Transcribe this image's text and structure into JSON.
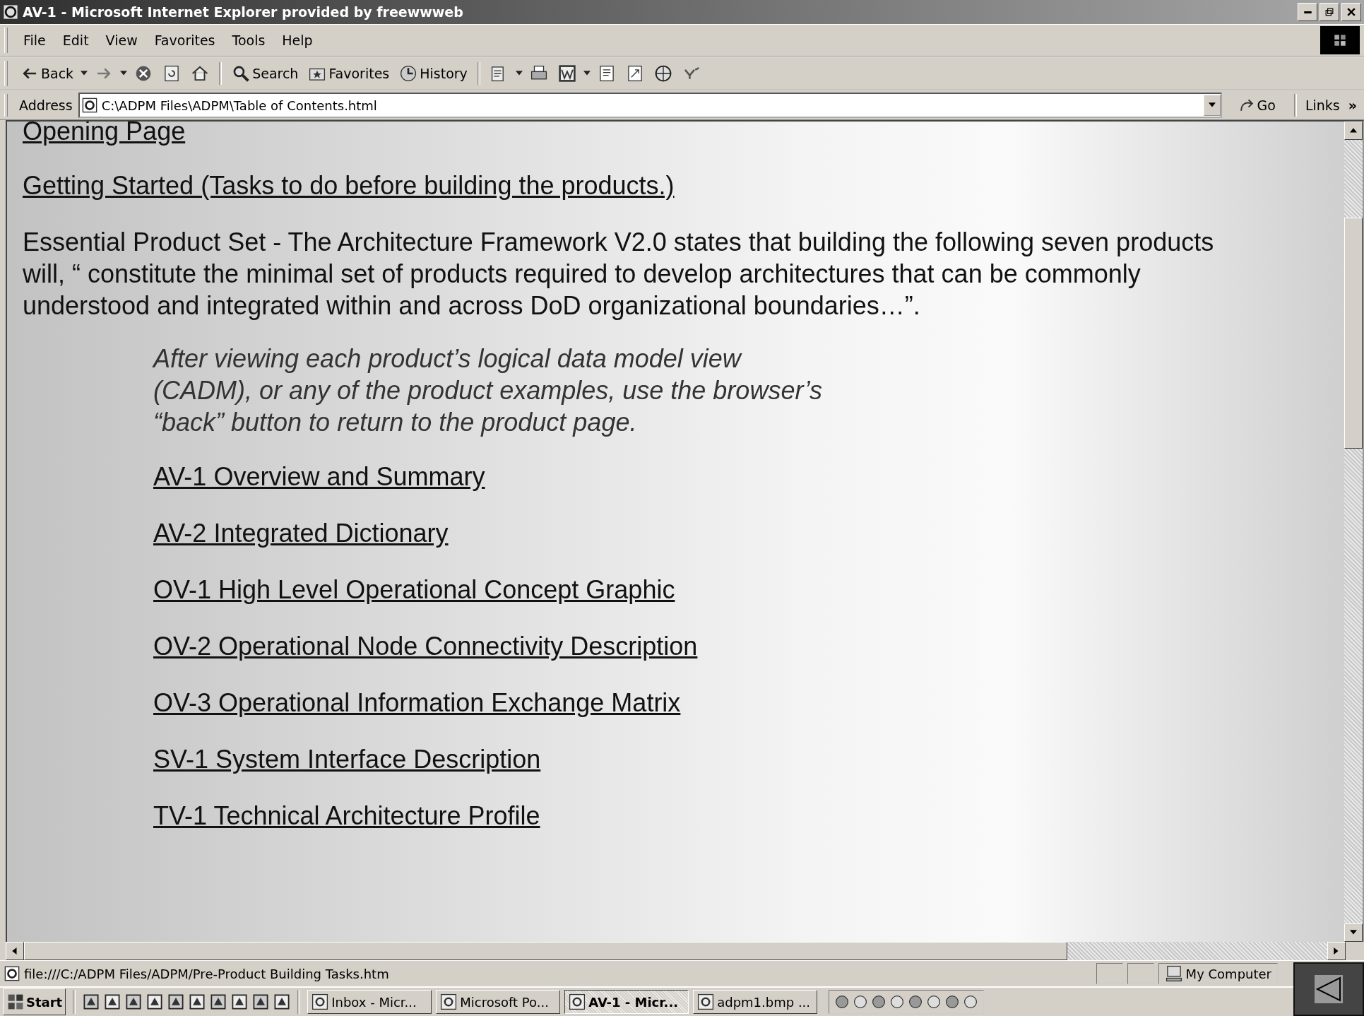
{
  "window": {
    "title": "AV-1 - Microsoft Internet Explorer provided by freewwweb"
  },
  "menu": [
    "File",
    "Edit",
    "View",
    "Favorites",
    "Tools",
    "Help"
  ],
  "toolbar": [
    {
      "kind": "back",
      "label": "Back"
    },
    {
      "kind": "forward"
    },
    {
      "kind": "stop"
    },
    {
      "kind": "refresh"
    },
    {
      "kind": "home"
    },
    {
      "kind": "search",
      "label": "Search"
    },
    {
      "kind": "favorites",
      "label": "Favorites"
    },
    {
      "kind": "history",
      "label": "History"
    },
    {
      "kind": "mail"
    },
    {
      "kind": "print"
    },
    {
      "kind": "edit"
    },
    {
      "kind": "discuss"
    },
    {
      "kind": "messenger"
    },
    {
      "kind": "globe"
    },
    {
      "kind": "yahoo"
    }
  ],
  "address": {
    "label": "Address",
    "value": "C:\\ADPM Files\\ADPM\\Table of Contents.html",
    "go": "Go",
    "links": "Links",
    "more": "»"
  },
  "content": {
    "top_links": [
      "Opening Page",
      "Getting Started  (Tasks to do before building the products.)"
    ],
    "intro": {
      "lead": "Essential Product Set",
      "text": "  - The Architecture Framework V2.0 states that building the following seven products will, “ constitute the minimal set of products required to develop architectures that can be commonly understood and integrated within and across DoD organizational boundaries…”."
    },
    "note": [
      "After viewing each product’s logical data model view",
      "(CADM), or any of the product examples, use the browser’s",
      "“back” button to return to the product page."
    ],
    "products": [
      "AV-1 Overview and Summary",
      "AV-2 Integrated Dictionary",
      "OV-1 High Level Operational Concept Graphic",
      "OV-2 Operational Node Connectivity Description",
      "OV-3 Operational Information Exchange Matrix",
      "SV-1 System Interface Description",
      "TV-1 Technical Architecture Profile"
    ]
  },
  "status_bar": {
    "text": "file:///C:/ADPM Files/ADPM/Pre-Product Building Tasks.htm",
    "zone": "My Computer"
  },
  "taskbar": {
    "start": "Start",
    "tasks": [
      {
        "label": "Inbox - Micr...",
        "selected": false
      },
      {
        "label": "Microsoft Po...",
        "selected": false
      },
      {
        "label": "AV-1 - Micr...",
        "selected": true
      },
      {
        "label": "adpm1.bmp ...",
        "selected": false
      }
    ]
  }
}
